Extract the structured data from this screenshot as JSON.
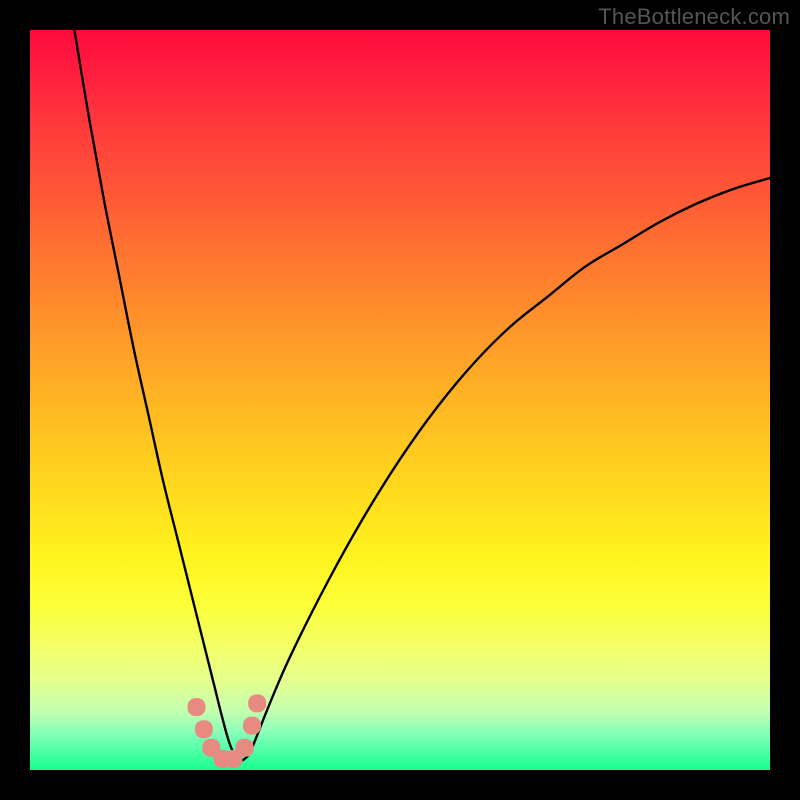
{
  "watermark": "TheBottleneck.com",
  "chart_data": {
    "type": "line",
    "title": "",
    "xlabel": "",
    "ylabel": "",
    "xlim": [
      0,
      100
    ],
    "ylim": [
      0,
      100
    ],
    "grid": false,
    "annotations": [],
    "series": [
      {
        "name": "bottleneck-curve",
        "color": "#000000",
        "x": [
          6,
          8,
          10,
          12,
          14,
          16,
          18,
          20,
          22,
          24,
          25,
          26,
          27,
          28,
          29,
          30,
          32,
          35,
          40,
          45,
          50,
          55,
          60,
          65,
          70,
          75,
          80,
          85,
          90,
          95,
          100
        ],
        "y": [
          100,
          88,
          77,
          67,
          57,
          48,
          39,
          31,
          23,
          15,
          11,
          7,
          3.5,
          1.5,
          1.5,
          3,
          8,
          15,
          25,
          34,
          42,
          49,
          55,
          60,
          64,
          68,
          71,
          74,
          76.5,
          78.5,
          80
        ]
      }
    ],
    "markers": [
      {
        "name": "highlight-points",
        "color": "#e78a82",
        "shape": "rounded-square",
        "x": [
          22.5,
          23.5,
          24.5,
          26.0,
          27.5,
          29.0,
          30.0,
          30.7
        ],
        "y": [
          8.5,
          5.5,
          3.0,
          1.5,
          1.5,
          3.0,
          6.0,
          9.0
        ]
      }
    ]
  },
  "colors": {
    "frame": "#000000",
    "curve": "#000000",
    "marker": "#e78a82",
    "watermark": "#555555"
  }
}
